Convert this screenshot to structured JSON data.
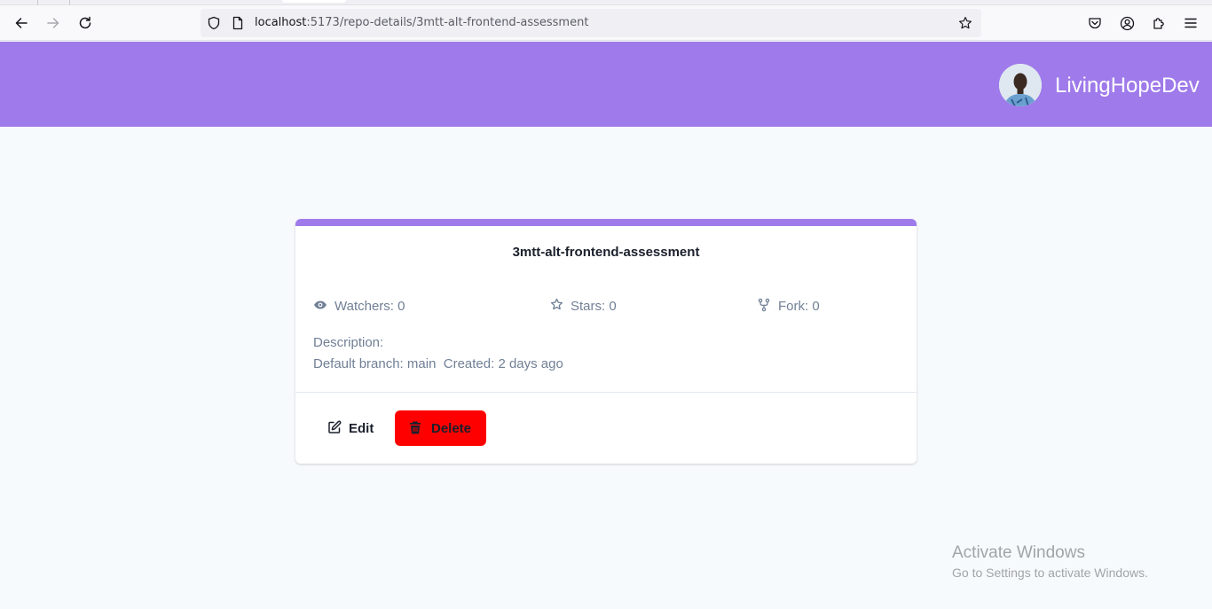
{
  "browser": {
    "url_host": "localhost",
    "url_path": ":5173/repo-details/3mtt-alt-frontend-assessment"
  },
  "header": {
    "username": "LivingHopeDev"
  },
  "repo": {
    "name": "3mtt-alt-frontend-assessment",
    "watchers": "Watchers: 0",
    "stars": "Stars: 0",
    "forks": "Fork: 0",
    "description": "Description:",
    "meta": "Default branch: main  Created: 2 days ago",
    "edit_label": "Edit",
    "delete_label": "Delete"
  },
  "watermark": {
    "title": "Activate Windows",
    "subtitle": "Go to Settings to activate Windows."
  },
  "colors": {
    "accent": "#9f7aea",
    "delete": "#ff0000",
    "muted_text": "#718096"
  },
  "icons": {
    "watchers": "eye-icon",
    "stars": "star-icon",
    "forks": "fork-icon",
    "edit": "edit-icon",
    "delete": "trash-icon"
  }
}
